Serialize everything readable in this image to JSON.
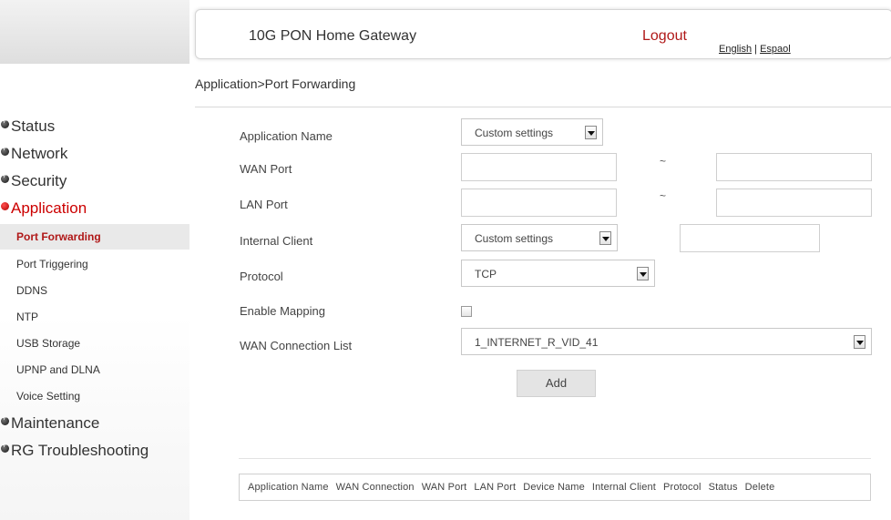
{
  "header": {
    "title": "10G PON Home Gateway",
    "logout": "Logout",
    "lang_english": "English",
    "lang_sep": "|",
    "lang_espanol": "Espaol"
  },
  "breadcrumb": "Application>Port Forwarding",
  "sidebar": {
    "status": "Status",
    "network": "Network",
    "security": "Security",
    "application": "Application",
    "sub_items": [
      "Port Forwarding",
      "Port Triggering",
      "DDNS",
      "NTP",
      "USB Storage",
      "UPNP and DLNA",
      "Voice Setting"
    ],
    "maintenance": "Maintenance",
    "rg_troubleshooting": "RG Troubleshooting"
  },
  "form": {
    "application_name_label": "Application Name",
    "application_name_value": "Custom settings",
    "wan_port_label": "WAN Port",
    "lan_port_label": "LAN Port",
    "range_sep": "~",
    "internal_client_label": "Internal Client",
    "internal_client_value": "Custom settings",
    "protocol_label": "Protocol",
    "protocol_value": "TCP",
    "enable_mapping_label": "Enable Mapping",
    "enable_mapping_checked": false,
    "wan_connection_label": "WAN Connection List",
    "wan_connection_value": "1_INTERNET_R_VID_41",
    "add_button": "Add"
  },
  "table": {
    "columns": [
      "Application Name",
      "WAN Connection",
      "WAN Port",
      "LAN Port",
      "Device Name",
      "Internal Client",
      "Protocol",
      "Status",
      "Delete"
    ]
  },
  "colors": {
    "accent_red": "#b01818",
    "active_bg": "#e9e9e9"
  }
}
